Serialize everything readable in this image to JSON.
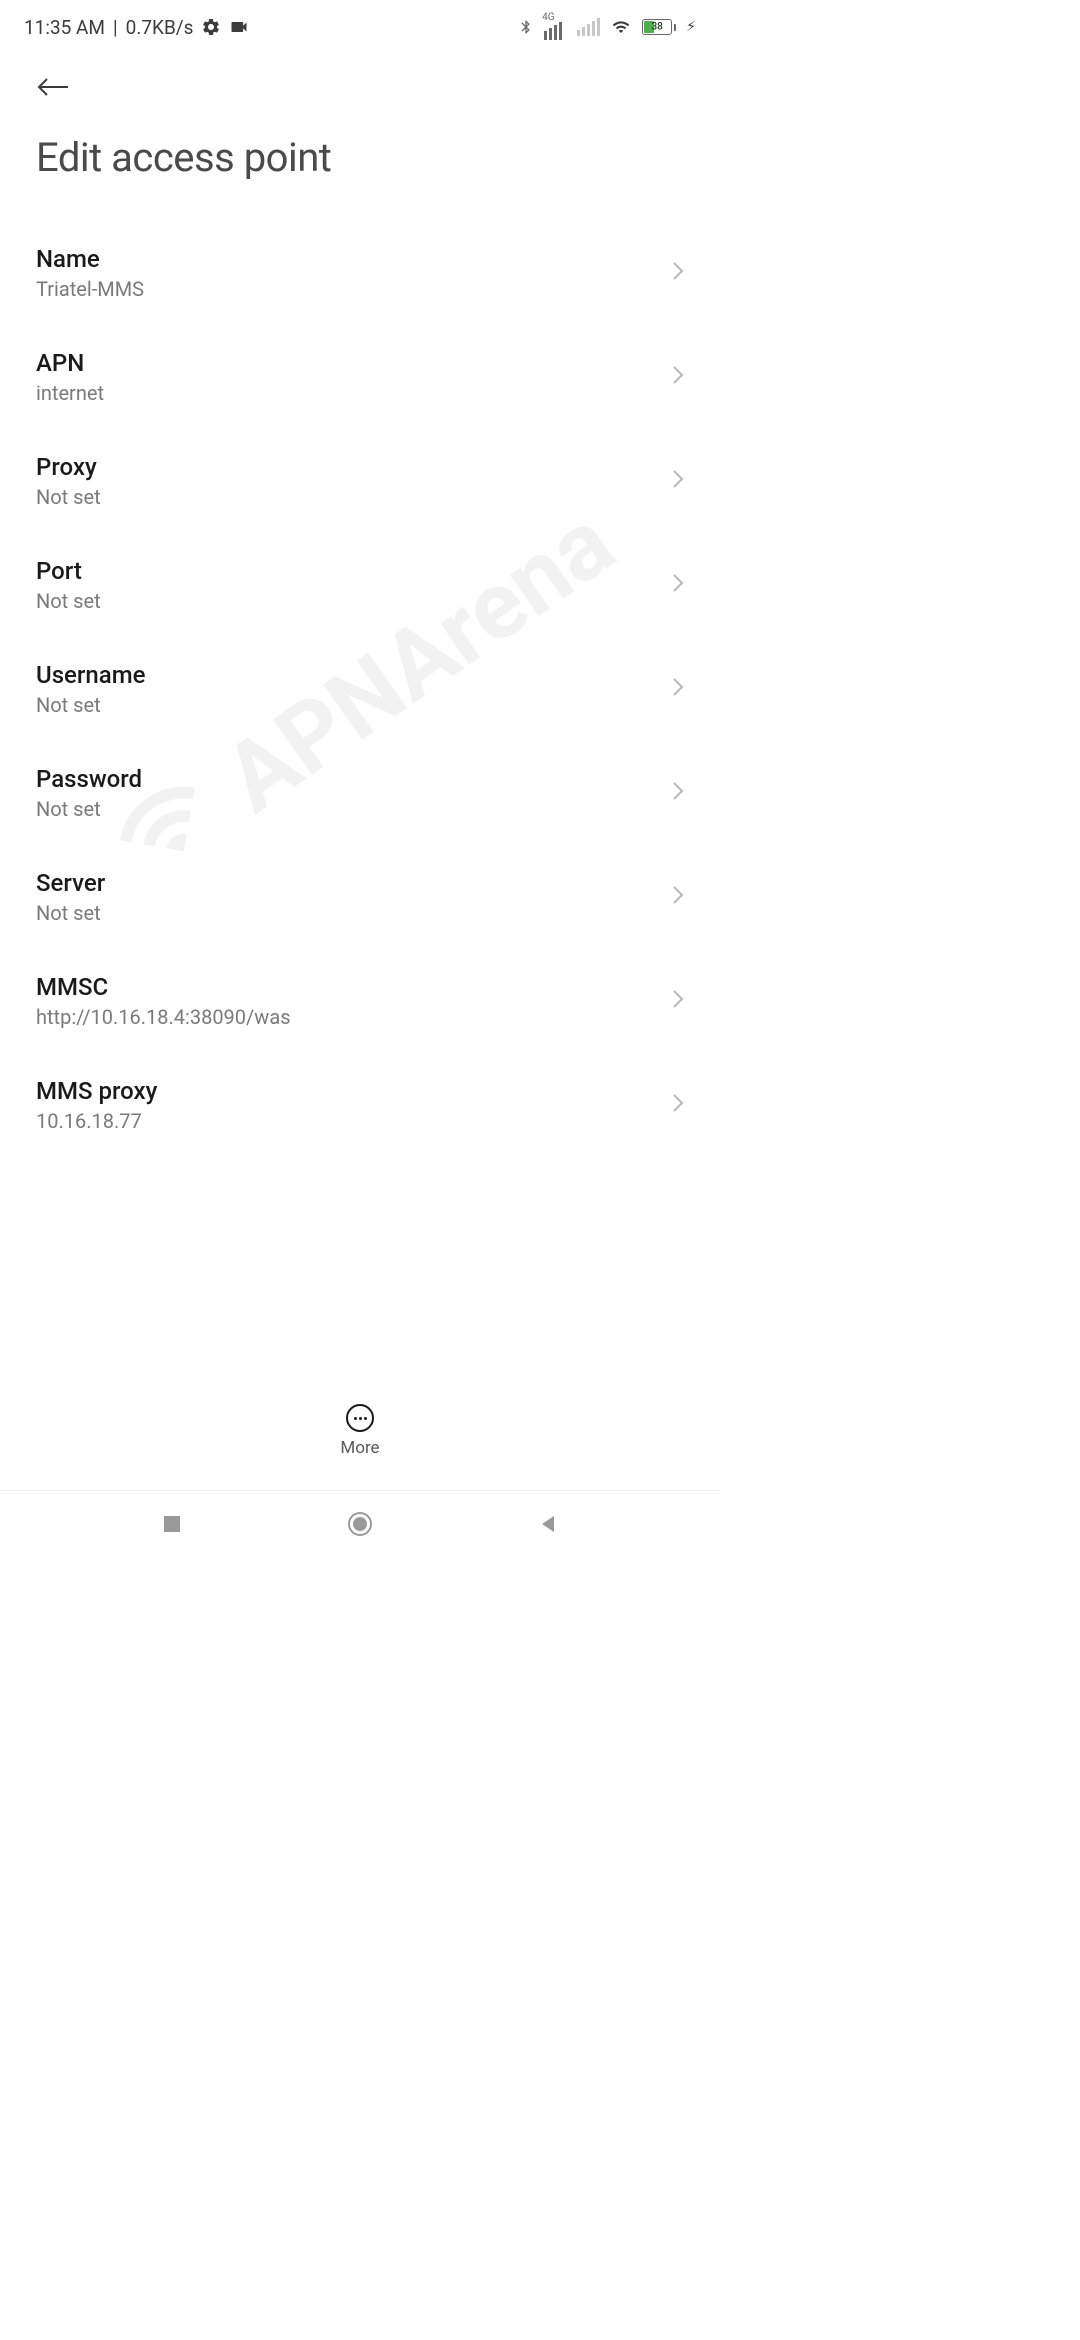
{
  "status": {
    "time": "11:35 AM",
    "data_rate": "0.7KB/s",
    "battery_percent": "38",
    "network_indicator": "4G"
  },
  "header": {
    "title": "Edit access point"
  },
  "settings": [
    {
      "label": "Name",
      "value": "Triatel-MMS"
    },
    {
      "label": "APN",
      "value": "internet"
    },
    {
      "label": "Proxy",
      "value": "Not set"
    },
    {
      "label": "Port",
      "value": "Not set"
    },
    {
      "label": "Username",
      "value": "Not set"
    },
    {
      "label": "Password",
      "value": "Not set"
    },
    {
      "label": "Server",
      "value": "Not set"
    },
    {
      "label": "MMSC",
      "value": "http://10.16.18.4:38090/was"
    },
    {
      "label": "MMS proxy",
      "value": "10.16.18.77"
    }
  ],
  "more_label": "More",
  "watermark": "APNArena"
}
